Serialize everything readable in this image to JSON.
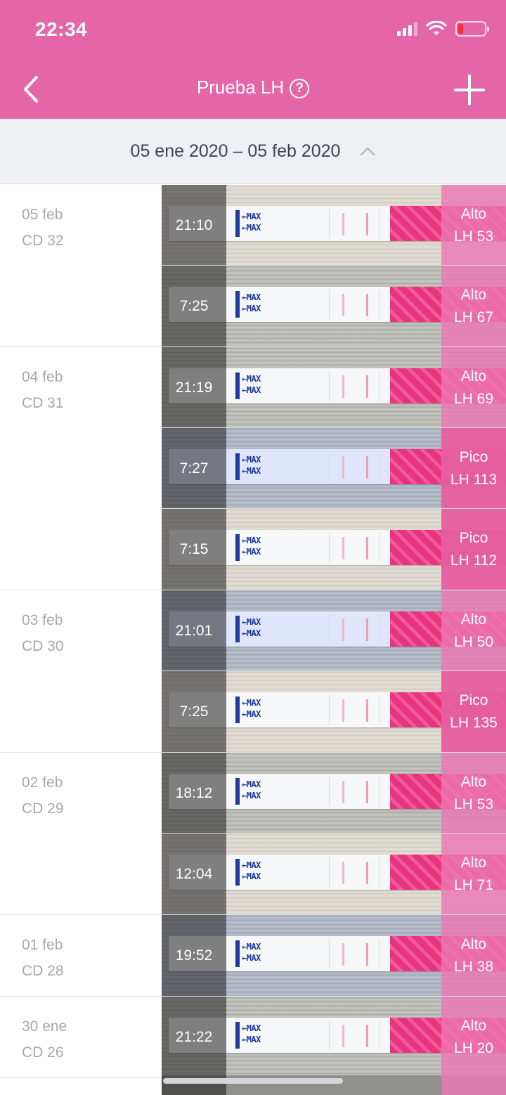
{
  "status_bar": {
    "time": "22:34"
  },
  "header": {
    "title": "Prueba LH",
    "help_icon": "question-circle-icon",
    "back_icon": "chevron-left-icon",
    "add_icon": "plus-icon"
  },
  "range": {
    "label": "05 ene 2020 – 05 feb 2020",
    "toggle_icon": "chevron-up-icon"
  },
  "colors": {
    "brand": "#e466a9",
    "range_bg": "#eff0f4",
    "label_gray": "#a6a8ad"
  },
  "days": [
    {
      "date": "05 feb",
      "cycle_day": "CD 32",
      "tests": [
        {
          "time": "21:10",
          "level": "Alto",
          "value": "LH 53"
        },
        {
          "time": "7:25",
          "level": "Alto",
          "value": "LH 67"
        }
      ]
    },
    {
      "date": "04 feb",
      "cycle_day": "CD 31",
      "tests": [
        {
          "time": "21:19",
          "level": "Alto",
          "value": "LH 69"
        },
        {
          "time": "7:27",
          "level": "Pico",
          "value": "LH 113"
        },
        {
          "time": "7:15",
          "level": "Pico",
          "value": "LH 112"
        }
      ]
    },
    {
      "date": "03 feb",
      "cycle_day": "CD 30",
      "tests": [
        {
          "time": "21:01",
          "level": "Alto",
          "value": "LH 50"
        },
        {
          "time": "7:25",
          "level": "Pico",
          "value": "LH 135"
        }
      ]
    },
    {
      "date": "02 feb",
      "cycle_day": "CD 29",
      "tests": [
        {
          "time": "18:12",
          "level": "Alto",
          "value": "LH 53"
        },
        {
          "time": "12:04",
          "level": "Alto",
          "value": "LH 71"
        }
      ]
    },
    {
      "date": "01 feb",
      "cycle_day": "CD 28",
      "tests": [
        {
          "time": "19:52",
          "level": "Alto",
          "value": "LH 38"
        }
      ]
    },
    {
      "date": "30 ene",
      "cycle_day": "CD 26",
      "tests": [
        {
          "time": "21:22",
          "level": "Alto",
          "value": "LH 20"
        }
      ]
    }
  ]
}
